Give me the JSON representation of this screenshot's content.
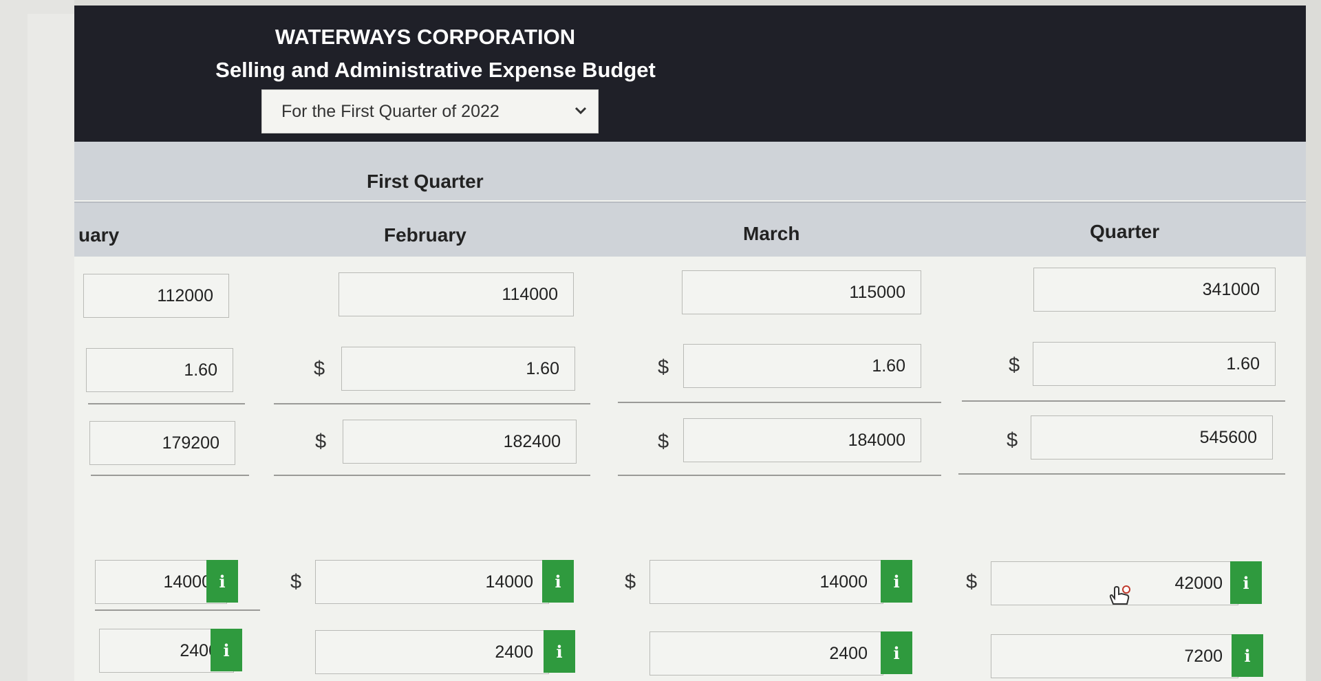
{
  "header": {
    "company": "WATERWAYS CORPORATION",
    "title": "Selling and Administrative Expense Budget",
    "period_value": "For the First Quarter of 2022"
  },
  "table": {
    "group_label": "First Quarter",
    "columns": [
      "uary",
      "February",
      "March",
      "Quarter"
    ],
    "currency_symbol": "$",
    "rows": {
      "units": [
        "112000",
        "114000",
        "115000",
        "341000"
      ],
      "rate": [
        "1.60",
        "1.60",
        "1.60",
        "1.60"
      ],
      "variable": [
        "179200",
        "182400",
        "184000",
        "545600"
      ],
      "fixed1": [
        "14000",
        "14000",
        "14000",
        "42000"
      ],
      "fixed2": [
        "2400",
        "2400",
        "2400",
        "7200"
      ]
    },
    "info_icon_glyph": "i"
  },
  "icons": {
    "info": "info-icon",
    "dropdown": "chevron-down-icon",
    "cursor": "hand-pointer-icon"
  },
  "colors": {
    "header_bg": "#1f2028",
    "band_bg": "#cfd3d8",
    "info_green": "#2f9a3e"
  }
}
